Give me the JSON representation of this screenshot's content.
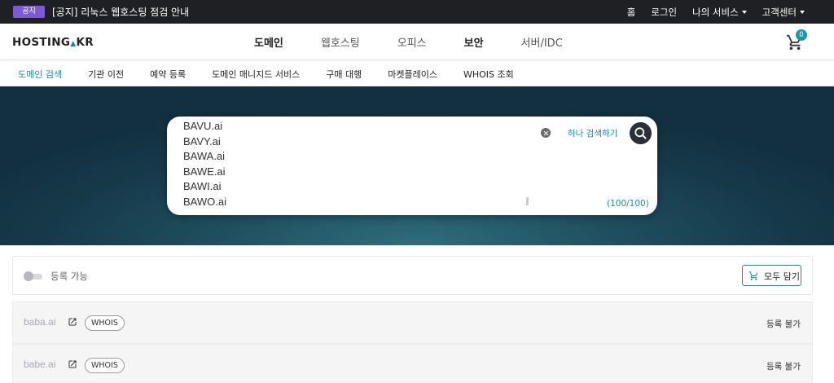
{
  "topbar": {
    "notice_badge": "공지",
    "notice_text": "[공지] 리눅스 웹호스팅 점검 안내",
    "links": [
      "홈",
      "로그인",
      "나의 서비스",
      "고객센터"
    ]
  },
  "header": {
    "logo": "HOSTING",
    "logo_suffix": "KR",
    "nav": [
      "도메인",
      "웹호스팅",
      "오피스",
      "보안",
      "서버/IDC"
    ],
    "cart_count": "0"
  },
  "subnav": {
    "items": [
      "도메인 검색",
      "기관 이전",
      "예약 등록",
      "도메인 매니지드 서비스",
      "구매 대행",
      "마켓플레이스",
      "WHOIS 조회"
    ]
  },
  "search": {
    "domains": [
      "BAVU.ai",
      "BAVY.ai",
      "BAWA.ai",
      "BAWE.ai",
      "BAWI.ai",
      "BAWO.ai"
    ],
    "single_search_label": "하나 검색하기",
    "counter": "(100/100)"
  },
  "filter": {
    "toggle_label": "등록 가능",
    "add_all_label": "모두 담기"
  },
  "results": [
    {
      "domain": "baba.ai",
      "whois": "WHOIS",
      "status": "등록 불가"
    },
    {
      "domain": "babe.ai",
      "whois": "WHOIS",
      "status": "등록 불가"
    }
  ],
  "colors": {
    "accent": "#1a8ea3",
    "notice_badge": "#7b5ad6",
    "topbar_bg": "#1f2023",
    "hero_bg": "#1f4f5e"
  }
}
